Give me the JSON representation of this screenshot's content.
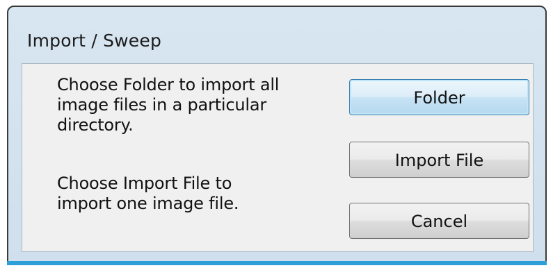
{
  "window": {
    "title": "Import / Sweep"
  },
  "message": {
    "folder_text": "Choose Folder to import all\nimage files in a particular\ndirectory.",
    "import_text": "Choose Import File to\nimport one image file."
  },
  "buttons": {
    "folder": "Folder",
    "import_file": "Import File",
    "cancel": "Cancel"
  },
  "colors": {
    "frame": "#d8e6f1",
    "accent": "#2f9fd8",
    "client": "#f0f0f0",
    "default_button_border": "#3c7fb1"
  }
}
